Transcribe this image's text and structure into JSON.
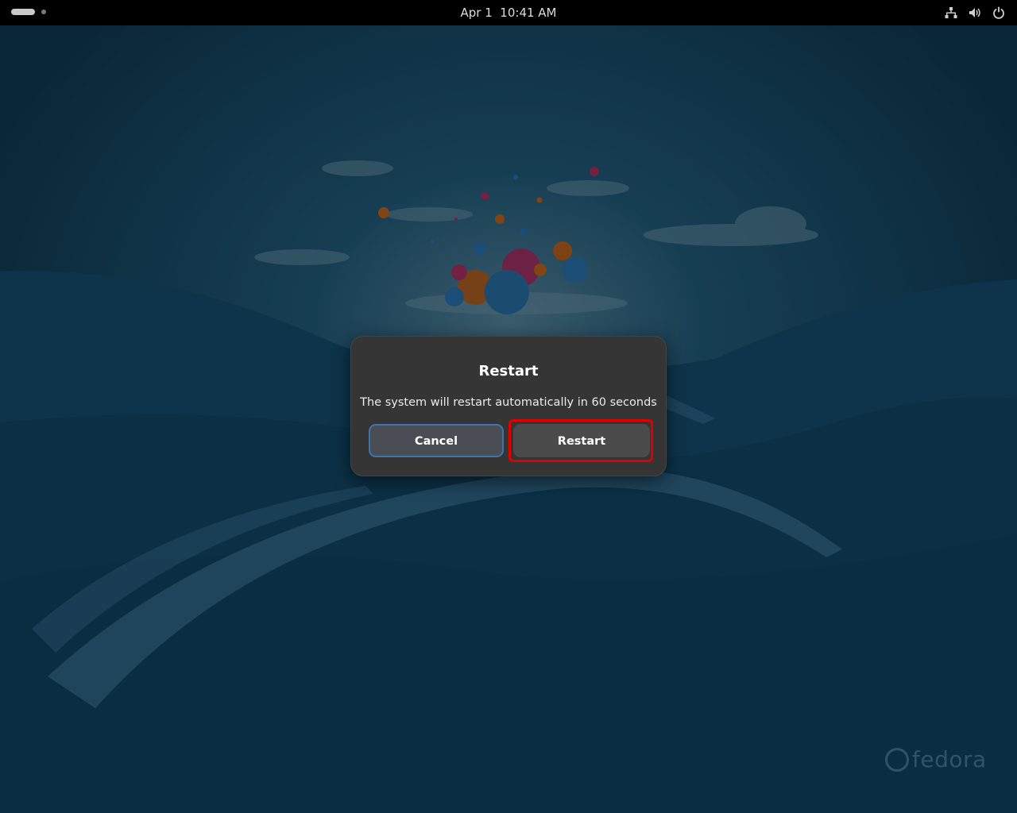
{
  "topbar": {
    "clock_date": "Apr 1",
    "clock_time": "10:41 AM",
    "tray_icons": [
      "network-icon",
      "volume-icon",
      "power-icon"
    ]
  },
  "wallpaper": {
    "brand": "fedora",
    "colors": {
      "sky": "#114a68",
      "hills": "#0f4566",
      "path": "#3d7aa0",
      "balloon_pink": "#c1366f",
      "balloon_orange": "#d2721f",
      "balloon_blue": "#2a7fc0"
    }
  },
  "dialog": {
    "title": "Restart",
    "message": "The system will restart automatically in 60 seconds",
    "cancel_label": "Cancel",
    "restart_label": "Restart"
  },
  "colors": {
    "dialog_bg": "#353535",
    "focus_ring": "#3f74b3",
    "annotation": "#e00000"
  }
}
